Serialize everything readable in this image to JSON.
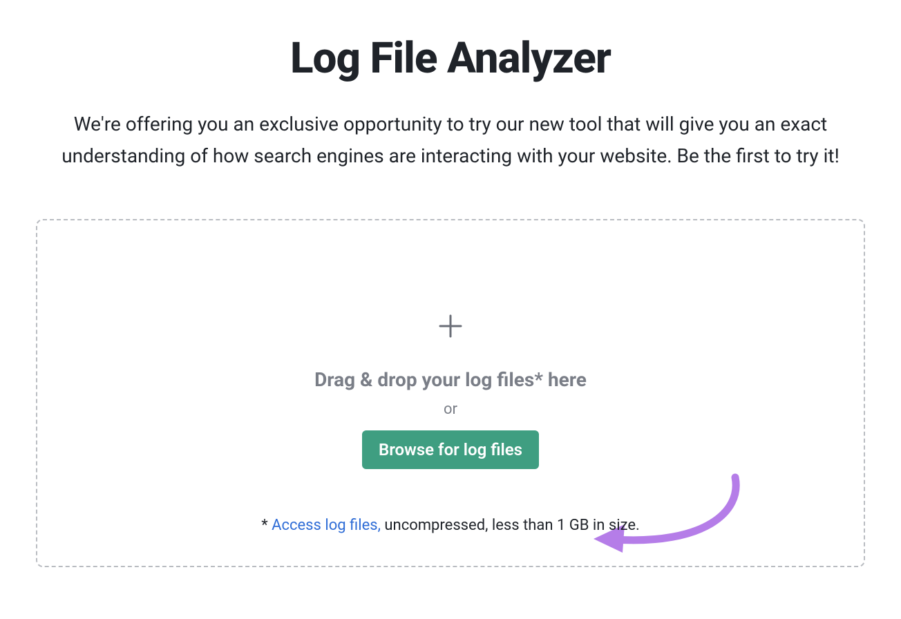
{
  "header": {
    "title": "Log File Analyzer",
    "description": "We're offering you an exclusive opportunity to try our new tool that will give you an exact understanding of how search engines are interacting with your website. Be the first to try it!"
  },
  "dropzone": {
    "drag_text": "Drag & drop your log files* here",
    "or_text": "or",
    "browse_button_label": "Browse for log files",
    "footnote_prefix": "* ",
    "footnote_link_text": "Access log files,",
    "footnote_suffix": " uncompressed, less than 1 GB in size."
  },
  "colors": {
    "button_bg": "#3f9e81",
    "link_color": "#2e6cd6",
    "annotation_arrow": "#b57de8"
  }
}
